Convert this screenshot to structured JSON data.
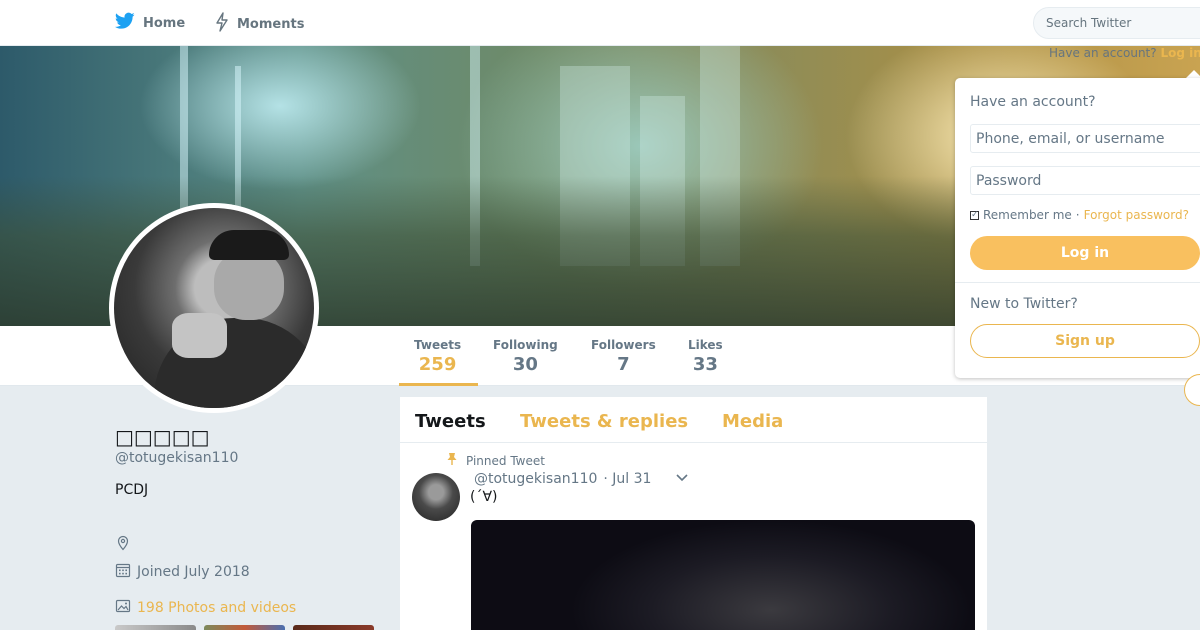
{
  "topbar": {
    "home_label": "Home",
    "moments_label": "Moments",
    "search_placeholder": "Search Twitter",
    "have_account_text": "Have an account?",
    "login_link": "Log in"
  },
  "profile": {
    "name": "□□□□□",
    "handle": "@totugekisan110",
    "bio": "PCDJ",
    "joined": "Joined July 2018",
    "photos_link": "198 Photos and videos"
  },
  "stats": [
    {
      "label": "Tweets",
      "value": "259"
    },
    {
      "label": "Following",
      "value": "30"
    },
    {
      "label": "Followers",
      "value": "7"
    },
    {
      "label": "Likes",
      "value": "33"
    }
  ],
  "timeline": {
    "tabs": [
      "Tweets",
      "Tweets & replies",
      "Media"
    ],
    "pinned_label": "Pinned Tweet",
    "tweet": {
      "handle": "@totugekisan110",
      "date": "· Jul 31",
      "text": "(´∀)"
    }
  },
  "login": {
    "title": "Have an account?",
    "username_placeholder": "Phone, email, or username",
    "password_placeholder": "Password",
    "remember_label": "Remember me",
    "separator": "·",
    "forgot_link": "Forgot password?",
    "login_button": "Log in",
    "new_text": "New to Twitter?",
    "signup_button": "Sign up"
  },
  "colors": {
    "accent": "#eab64f",
    "twitter_blue": "#1da1f2"
  },
  "icons": [
    "twitter-bird-icon",
    "moments-icon",
    "location-icon",
    "calendar-icon",
    "photo-icon",
    "pin-icon",
    "chevron-down-icon"
  ]
}
